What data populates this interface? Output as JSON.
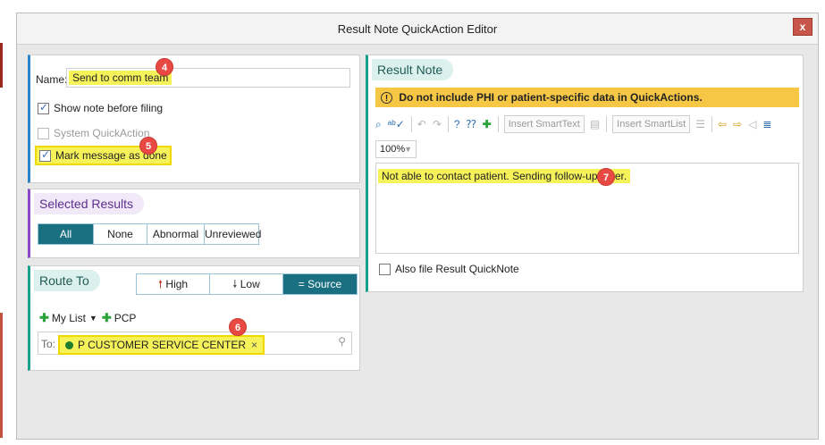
{
  "window": {
    "title": "Result Note QuickAction Editor",
    "close_label": "x"
  },
  "left_panel": {
    "name_label": "Name:",
    "name_value": "Send to comm team",
    "show_note_label": "Show note before filing",
    "system_quickaction_label": "System QuickAction",
    "mark_message_label": "Mark message as done"
  },
  "selected_results": {
    "title": "Selected Results",
    "options": [
      "All",
      "None",
      "Abnormal",
      "Unreviewed"
    ],
    "active": "All"
  },
  "route_to": {
    "title": "Route To",
    "priority": {
      "high": "High",
      "low": "Low",
      "source": "Source"
    },
    "my_list_label": "My List",
    "pcp_label": "PCP",
    "to_label": "To:",
    "recipient": "P CUSTOMER SERVICE CENTER",
    "remove_symbol": "×"
  },
  "result_note": {
    "title": "Result Note",
    "warning": "Do not include PHI or patient-specific data in QuickActions.",
    "insert_smarttext_placeholder": "Insert SmartText",
    "insert_smartlist_placeholder": "Insert SmartList",
    "zoom": "100%",
    "body_text": "Not able to contact patient. Sending follow-up letter.",
    "also_file_label": "Also file Result QuickNote"
  },
  "annotations": {
    "badge4": "4",
    "badge5": "5",
    "badge6": "6",
    "badge7": "7"
  },
  "colors": {
    "active_segment": "#1a6f80",
    "highlight": "#f6f25a",
    "warning_bar": "#f6c744",
    "badge": "#e84a43"
  }
}
